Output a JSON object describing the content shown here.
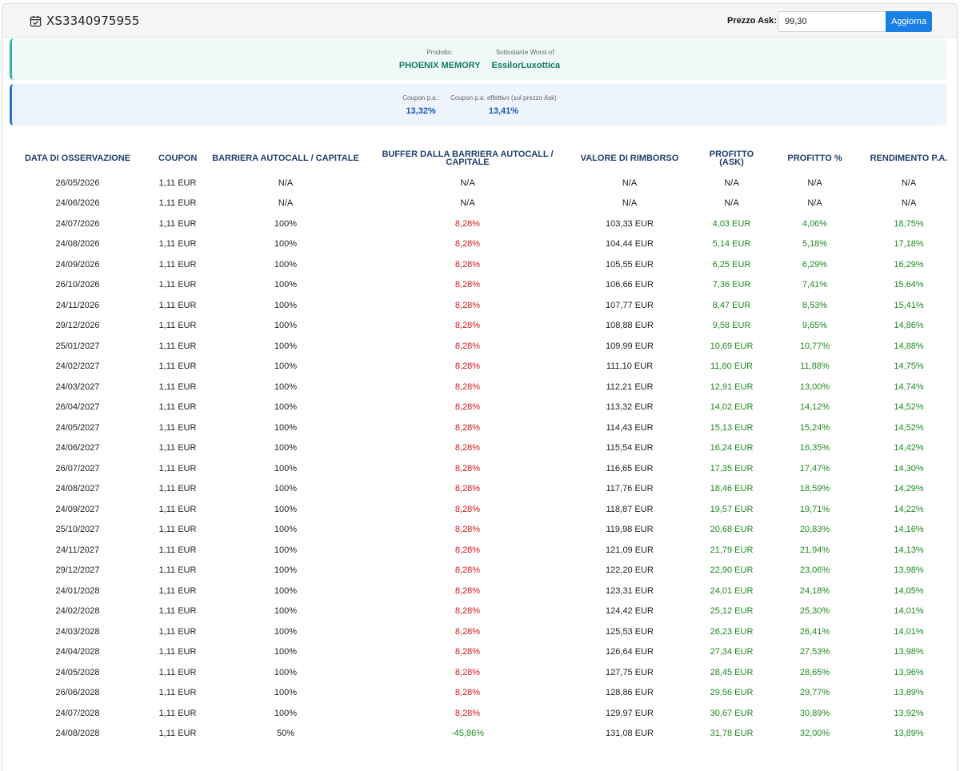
{
  "header": {
    "title": "XS3340975955",
    "calendar_icon": "calendar-check-icon"
  },
  "ask": {
    "label": "Prezzo Ask:",
    "value": "99,30",
    "button_label": "Aggiorna"
  },
  "product_panel": {
    "prodotto_label": "Prodotto:",
    "prodotto_value": "PHOENIX MEMORY",
    "sottostante_label": "Sottostante Worst-of:",
    "sottostante_value": "EssilorLuxottica"
  },
  "coupon_panel": {
    "coupon_label": "Coupon p.a.:",
    "coupon_value": "13,32%",
    "effettivo_label": "Coupon p.a. effettivo (sul prezzo Ask)",
    "effettivo_value": "13,41%"
  },
  "colors": {
    "accent_blue": "#1a80e6",
    "header_text": "#1f3f6b",
    "negative": "#d6151b",
    "positive": "#1e8a1e"
  },
  "table": {
    "headers": [
      "DATA DI OSSERVAZIONE",
      "COUPON",
      "BARRIERA AUTOCALL / CAPITALE",
      "BUFFER DALLA BARRIERA AUTOCALL / CAPITALE",
      "VALORE DI RIMBORSO",
      "PROFITTO (ASK)",
      "PROFITTO %",
      "RENDIMENTO P.A."
    ],
    "rows": [
      [
        "26/05/2026",
        "1,11 EUR",
        "N/A",
        "N/A",
        "N/A",
        "N/A",
        "N/A",
        "N/A"
      ],
      [
        "24/06/2026",
        "1,11 EUR",
        "N/A",
        "N/A",
        "N/A",
        "N/A",
        "N/A",
        "N/A"
      ],
      [
        "24/07/2026",
        "1,11 EUR",
        "100%",
        "8,28%",
        "103,33 EUR",
        "4,03 EUR",
        "4,06%",
        "18,75%"
      ],
      [
        "24/08/2026",
        "1,11 EUR",
        "100%",
        "8,28%",
        "104,44 EUR",
        "5,14 EUR",
        "5,18%",
        "17,18%"
      ],
      [
        "24/09/2026",
        "1,11 EUR",
        "100%",
        "8,28%",
        "105,55 EUR",
        "6,25 EUR",
        "6,29%",
        "16,29%"
      ],
      [
        "26/10/2026",
        "1,11 EUR",
        "100%",
        "8,28%",
        "106,66 EUR",
        "7,36 EUR",
        "7,41%",
        "15,64%"
      ],
      [
        "24/11/2026",
        "1,11 EUR",
        "100%",
        "8,28%",
        "107,77 EUR",
        "8,47 EUR",
        "8,53%",
        "15,41%"
      ],
      [
        "29/12/2026",
        "1,11 EUR",
        "100%",
        "8,28%",
        "108,88 EUR",
        "9,58 EUR",
        "9,65%",
        "14,86%"
      ],
      [
        "25/01/2027",
        "1,11 EUR",
        "100%",
        "8,28%",
        "109,99 EUR",
        "10,69 EUR",
        "10,77%",
        "14,88%"
      ],
      [
        "24/02/2027",
        "1,11 EUR",
        "100%",
        "8,28%",
        "111,10 EUR",
        "11,80 EUR",
        "11,88%",
        "14,75%"
      ],
      [
        "24/03/2027",
        "1,11 EUR",
        "100%",
        "8,28%",
        "112,21 EUR",
        "12,91 EUR",
        "13,00%",
        "14,74%"
      ],
      [
        "26/04/2027",
        "1,11 EUR",
        "100%",
        "8,28%",
        "113,32 EUR",
        "14,02 EUR",
        "14,12%",
        "14,52%"
      ],
      [
        "24/05/2027",
        "1,11 EUR",
        "100%",
        "8,28%",
        "114,43 EUR",
        "15,13 EUR",
        "15,24%",
        "14,52%"
      ],
      [
        "24/06/2027",
        "1,11 EUR",
        "100%",
        "8,28%",
        "115,54 EUR",
        "16,24 EUR",
        "16,35%",
        "14,42%"
      ],
      [
        "26/07/2027",
        "1,11 EUR",
        "100%",
        "8,28%",
        "116,65 EUR",
        "17,35 EUR",
        "17,47%",
        "14,30%"
      ],
      [
        "24/08/2027",
        "1,11 EUR",
        "100%",
        "8,28%",
        "117,76 EUR",
        "18,46 EUR",
        "18,59%",
        "14,29%"
      ],
      [
        "24/09/2027",
        "1,11 EUR",
        "100%",
        "8,28%",
        "118,87 EUR",
        "19,57 EUR",
        "19,71%",
        "14,22%"
      ],
      [
        "25/10/2027",
        "1,11 EUR",
        "100%",
        "8,28%",
        "119,98 EUR",
        "20,68 EUR",
        "20,83%",
        "14,16%"
      ],
      [
        "24/11/2027",
        "1,11 EUR",
        "100%",
        "8,28%",
        "121,09 EUR",
        "21,79 EUR",
        "21,94%",
        "14,13%"
      ],
      [
        "29/12/2027",
        "1,11 EUR",
        "100%",
        "8,28%",
        "122,20 EUR",
        "22,90 EUR",
        "23,06%",
        "13,98%"
      ],
      [
        "24/01/2028",
        "1,11 EUR",
        "100%",
        "8,28%",
        "123,31 EUR",
        "24,01 EUR",
        "24,18%",
        "14,05%"
      ],
      [
        "24/02/2028",
        "1,11 EUR",
        "100%",
        "8,28%",
        "124,42 EUR",
        "25,12 EUR",
        "25,30%",
        "14,01%"
      ],
      [
        "24/03/2028",
        "1,11 EUR",
        "100%",
        "8,28%",
        "125,53 EUR",
        "26,23 EUR",
        "26,41%",
        "14,01%"
      ],
      [
        "24/04/2028",
        "1,11 EUR",
        "100%",
        "8,28%",
        "126,64 EUR",
        "27,34 EUR",
        "27,53%",
        "13,98%"
      ],
      [
        "24/05/2028",
        "1,11 EUR",
        "100%",
        "8,28%",
        "127,75 EUR",
        "28,45 EUR",
        "28,65%",
        "13,96%"
      ],
      [
        "26/06/2028",
        "1,11 EUR",
        "100%",
        "8,28%",
        "128,86 EUR",
        "29,56 EUR",
        "29,77%",
        "13,89%"
      ],
      [
        "24/07/2028",
        "1,11 EUR",
        "100%",
        "8,28%",
        "129,97 EUR",
        "30,67 EUR",
        "30,89%",
        "13,92%"
      ],
      [
        "24/08/2028",
        "1,11 EUR",
        "50%",
        "-45,86%",
        "131,08 EUR",
        "31,78 EUR",
        "32,00%",
        "13,89%"
      ]
    ]
  }
}
